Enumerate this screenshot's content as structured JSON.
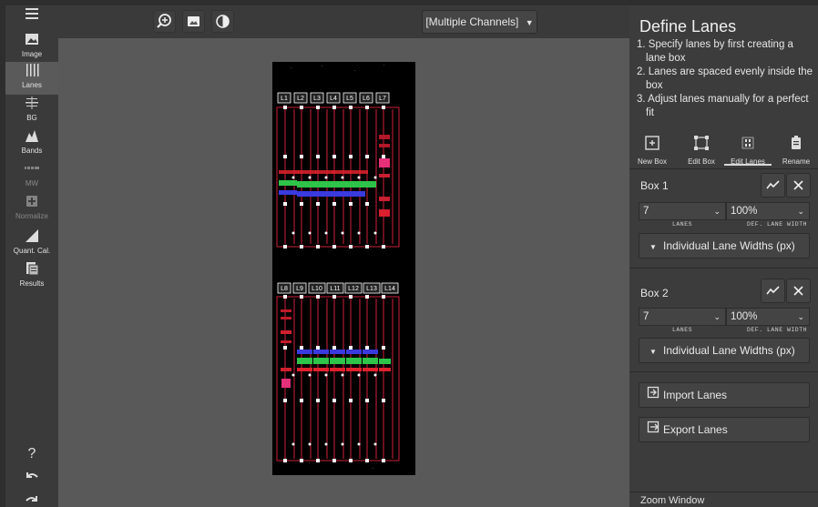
{
  "sidebar": {
    "items": [
      {
        "name": "image",
        "label": "Image",
        "icon": "image-icon"
      },
      {
        "name": "lanes",
        "label": "Lanes",
        "icon": "lanes-icon",
        "active": true
      },
      {
        "name": "bg",
        "label": "BG",
        "icon": "bg-icon"
      },
      {
        "name": "bands",
        "label": "Bands",
        "icon": "bands-icon"
      },
      {
        "name": "mw",
        "label": "MW",
        "icon": "mw-icon",
        "disabled": true
      },
      {
        "name": "normalize",
        "label": "Normalize",
        "icon": "normalize-icon",
        "disabled": true
      },
      {
        "name": "quant-cal",
        "label": "Quant. Cal.",
        "icon": "quant-cal-icon"
      },
      {
        "name": "results",
        "label": "Results",
        "icon": "results-icon"
      }
    ],
    "help": "?"
  },
  "toolbar": {
    "channel_select": "[Multiple Channels]"
  },
  "blot": {
    "lane_labels_top": [
      "L1",
      "L2",
      "L3",
      "L4",
      "L5",
      "L6",
      "L7"
    ],
    "lane_labels_bottom": [
      "L8",
      "L9",
      "L10",
      "L11",
      "L12",
      "L13",
      "L14"
    ]
  },
  "panel": {
    "title": "Define Lanes",
    "steps": [
      "1. Specify lanes by first creating a lane box",
      "2. Lanes are spaced evenly inside the box",
      "3. Adjust lanes manually for a perfect fit"
    ],
    "tools": [
      {
        "label": "New Box",
        "icon": "new-box-icon"
      },
      {
        "label": "Edit Box",
        "icon": "edit-box-icon"
      },
      {
        "label": "Edit Lanes",
        "icon": "edit-lanes-icon",
        "active": true
      },
      {
        "label": "Rename",
        "icon": "rename-icon"
      }
    ],
    "boxes": [
      {
        "label": "Box 1",
        "lanes": "7",
        "lane_width": "100%",
        "lanes_caption": "LANES",
        "width_caption": "DEF. LANE WIDTH",
        "widths_toggle": "Individual Lane Widths (px)"
      },
      {
        "label": "Box 2",
        "lanes": "7",
        "lane_width": "100%",
        "lanes_caption": "LANES",
        "width_caption": "DEF. LANE WIDTH",
        "widths_toggle": "Individual Lane Widths (px)"
      }
    ],
    "import_label": "Import Lanes",
    "export_label": "Export Lanes",
    "zoom_window": "Zoom Window"
  },
  "colors": {
    "lane_outline": "#d0213c",
    "handle": "#ffffff",
    "band_red": "#e0222d",
    "band_green": "#2ec44a",
    "band_blue": "#3a3adf",
    "band_magenta": "#e6307a"
  }
}
